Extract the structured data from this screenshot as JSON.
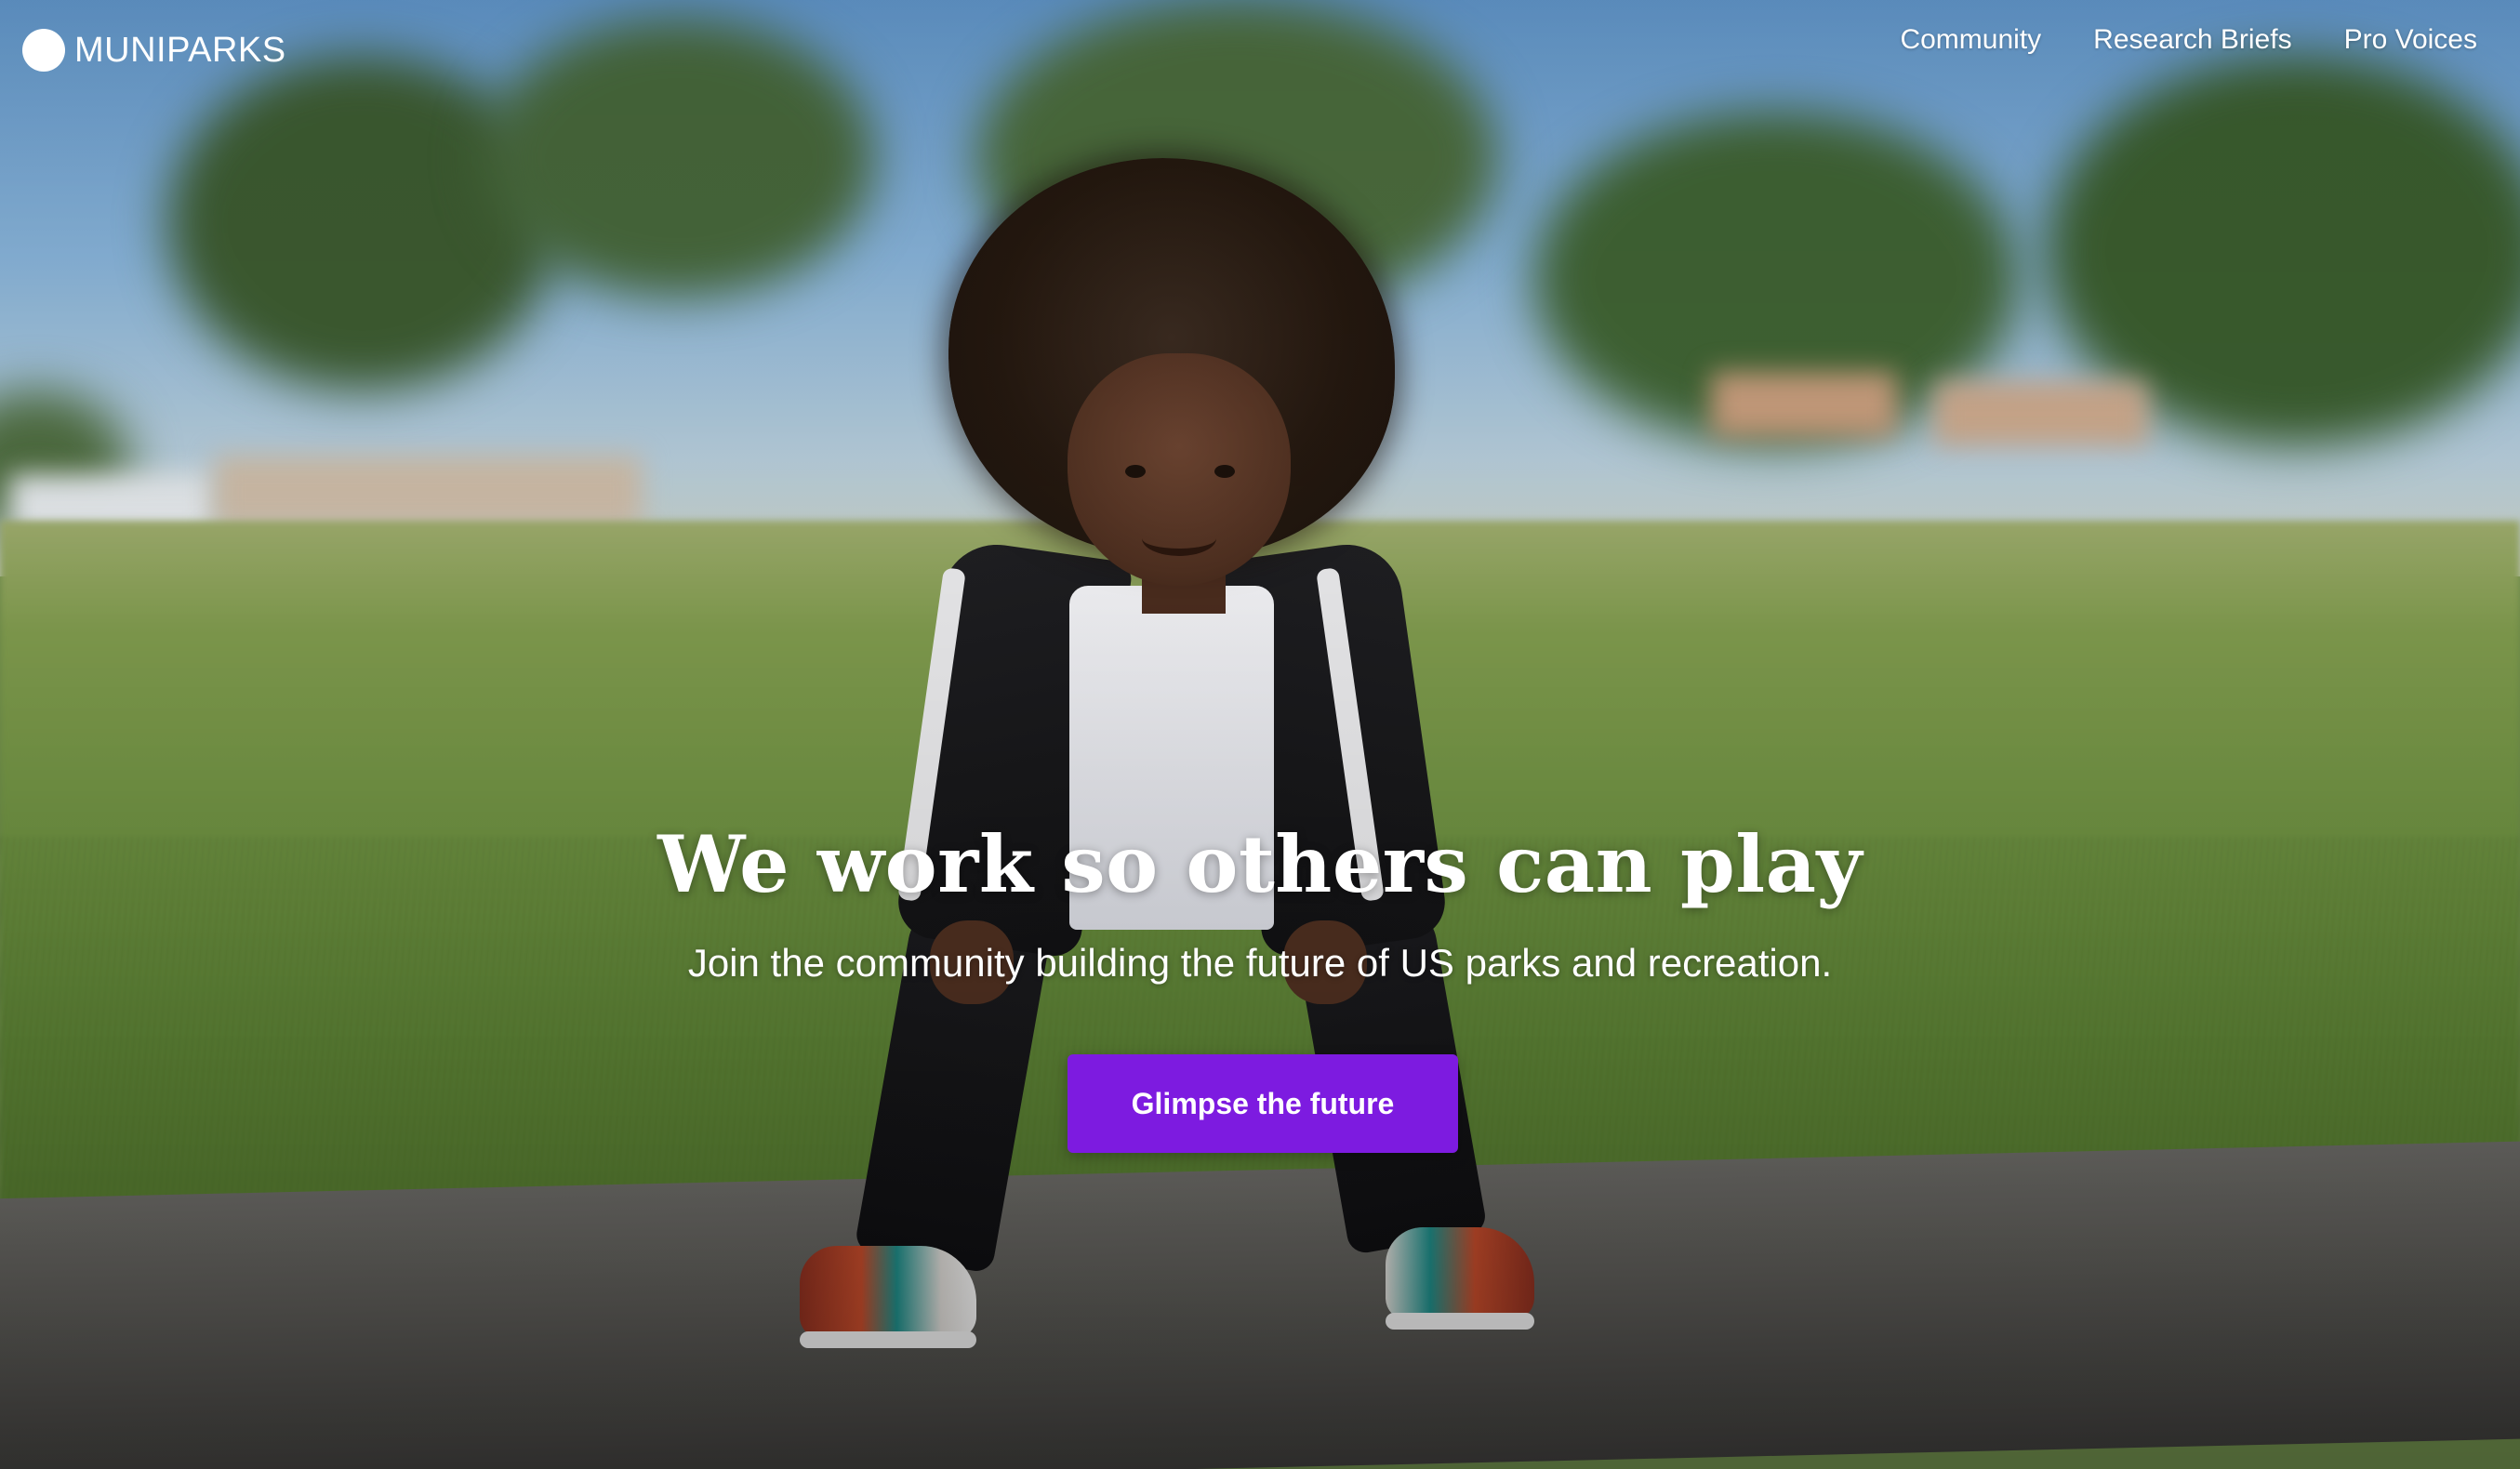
{
  "brand": {
    "name": "MUNIPARKS",
    "logo_icon": "circle-logo-icon"
  },
  "nav": {
    "links": [
      {
        "label": "Community"
      },
      {
        "label": "Research Briefs"
      },
      {
        "label": "Pro Voices"
      }
    ]
  },
  "hero": {
    "headline": "We work so others can play",
    "subheadline": "Join the community building the future of US parks and recreation.",
    "cta_label": "Glimpse the future",
    "background_image": "child-in-park-photo"
  },
  "colors": {
    "cta_background": "#7d1be0",
    "text": "#ffffff"
  }
}
